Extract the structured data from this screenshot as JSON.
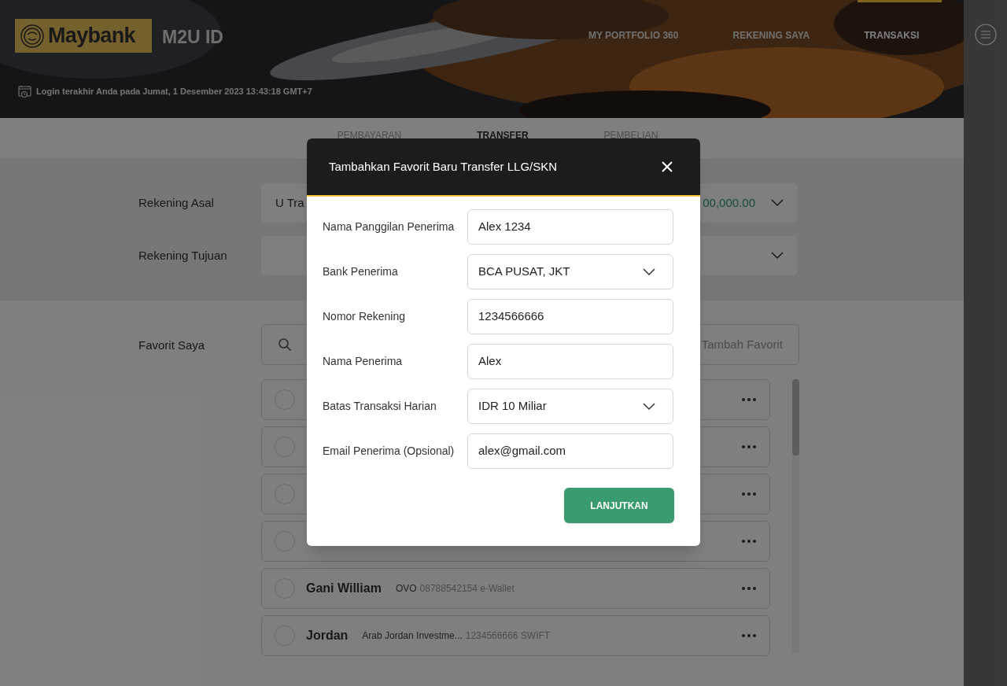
{
  "header": {
    "brand": "Maybank",
    "product": "M2U ID",
    "last_login": "Login terakhir Anda pada Jumat, 1 Desember 2023 13:43:18 GMT+7",
    "nav": [
      {
        "label": "MY PORTFOLIO 360",
        "selected": false
      },
      {
        "label": "REKENING SAYA",
        "selected": false
      },
      {
        "label": "TRANSAKSI",
        "selected": true
      }
    ]
  },
  "subtabs": [
    {
      "label": "PEMBAYARAN",
      "selected": false
    },
    {
      "label": "TRANSFER",
      "selected": true
    },
    {
      "label": "PEMBELIAN",
      "selected": false
    }
  ],
  "form": {
    "from": {
      "label": "Rekening Asal",
      "value": "U Tra",
      "amount": "00,000.00"
    },
    "to": {
      "label": "Rekening Tujuan"
    }
  },
  "favorites": {
    "label": "Favorit Saya",
    "add_label": "Tambah Favorit",
    "rows": [
      {
        "selected": false
      },
      {
        "selected": false
      },
      {
        "selected": false
      },
      {
        "selected": false
      },
      {
        "selected": false,
        "name": "Gani William",
        "bank": "OVO",
        "detail": "08788542154 e-Wallet"
      },
      {
        "selected": false,
        "name": "Jordan",
        "bank": "Arab Jordan Investme...",
        "detail": "1234566666 SWIFT"
      }
    ]
  },
  "modal": {
    "title": "Tambahkan Favorit Baru Transfer LLG/SKN",
    "fields": [
      {
        "label": "Nama Panggilan Penerima",
        "value": "Alex 1234",
        "kind": "text"
      },
      {
        "label": "Bank Penerima",
        "value": "BCA PUSAT, JKT",
        "kind": "select"
      },
      {
        "label": "Nomor Rekening",
        "value": "1234566666",
        "kind": "text"
      },
      {
        "label": "Nama Penerima",
        "value": "Alex",
        "kind": "text"
      },
      {
        "label": "Batas Transaksi Harian",
        "value": "IDR 10 Miliar",
        "kind": "select"
      },
      {
        "label": "Email Penerima (Opsional)",
        "value": "alex@gmail.com",
        "kind": "text"
      }
    ],
    "button": "LANJUTKAN"
  }
}
